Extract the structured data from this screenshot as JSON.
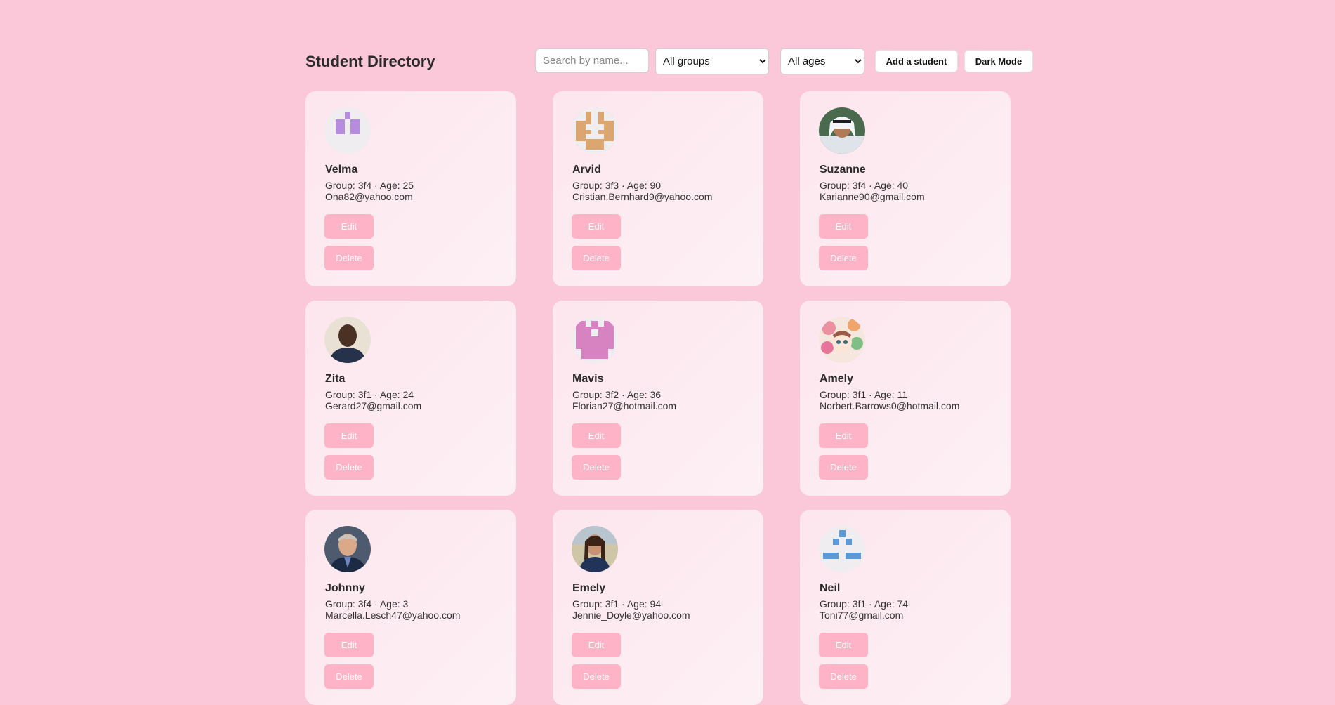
{
  "header": {
    "title": "Student Directory",
    "search_placeholder": "Search by name...",
    "group_filter": "All groups",
    "age_filter": "All ages",
    "add_label": "Add a student",
    "dark_mode_label": "Dark Mode"
  },
  "card_labels": {
    "edit": "Edit",
    "delete": "Delete"
  },
  "students": [
    {
      "name": "Velma",
      "meta": "Group: 3f4 · Age: 25",
      "email": "Ona82@yahoo.com",
      "avatar": "identicon-purple"
    },
    {
      "name": "Arvid",
      "meta": "Group: 3f3 · Age: 90",
      "email": "Cristian.Bernhard9@yahoo.com",
      "avatar": "identicon-tan"
    },
    {
      "name": "Suzanne",
      "meta": "Group: 3f4 · Age: 40",
      "email": "Karianne90@gmail.com",
      "avatar": "photo-man-white-headdress"
    },
    {
      "name": "Zita",
      "meta": "Group: 3f1 · Age: 24",
      "email": "Gerard27@gmail.com",
      "avatar": "photo-man-smiling"
    },
    {
      "name": "Mavis",
      "meta": "Group: 3f2 · Age: 36",
      "email": "Florian27@hotmail.com",
      "avatar": "identicon-pink"
    },
    {
      "name": "Amely",
      "meta": "Group: 3f1 · Age: 11",
      "email": "Norbert.Barrows0@hotmail.com",
      "avatar": "illustration-floral-girl"
    },
    {
      "name": "Johnny",
      "meta": "Group: 3f4 · Age: 3",
      "email": "Marcella.Lesch47@yahoo.com",
      "avatar": "photo-man-suit"
    },
    {
      "name": "Emely",
      "meta": "Group: 3f1 · Age: 94",
      "email": "Jennie_Doyle@yahoo.com",
      "avatar": "photo-woman-outdoor"
    },
    {
      "name": "Neil",
      "meta": "Group: 3f1 · Age: 74",
      "email": "Toni77@gmail.com",
      "avatar": "identicon-blue"
    }
  ]
}
